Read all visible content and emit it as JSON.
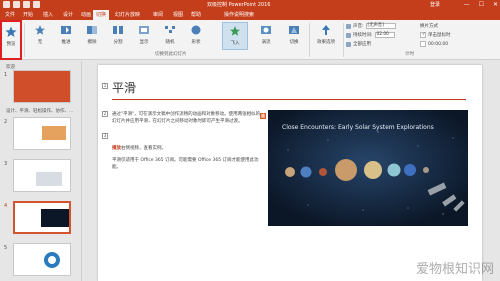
{
  "window": {
    "title": "双级控制 PowerPoint 2016",
    "signin": "登录"
  },
  "tabs": [
    "文件",
    "开始",
    "插入",
    "设计",
    "切换",
    "动画",
    "幻灯片放映",
    "审阅",
    "视图",
    "帮助"
  ],
  "active_tab": "切换",
  "tell_me": "操作说明搜索",
  "ribbon": {
    "preview_label": "预览",
    "preview_group": "预览",
    "transitions": [
      "无",
      "推进",
      "擦除",
      "分割",
      "显示",
      "随机",
      "形状",
      "飞入",
      "涡流",
      "切换"
    ],
    "transitions_group": "切换到此幻灯片",
    "effect_options": "效果选项",
    "sound_label": "声音:",
    "sound_value": "[无声音]",
    "duration_label": "持续时间:",
    "duration_value": "02.00",
    "apply_all": "全部应用",
    "timing_group": "计时",
    "advance_label": "换片方式",
    "on_click": "单击鼠标时",
    "after_label": "设置自动换片时间:",
    "after_value": "00:00.00"
  },
  "thumbnails": {
    "sections": [
      "欢迎",
      "设计、平滑、轻松操作、协作、..."
    ],
    "numbers": [
      "1",
      "2",
      "3",
      "4",
      "5"
    ],
    "selected": "4"
  },
  "slide": {
    "title": "平滑",
    "p1": "通过\"平滑\"，可在演示文稿中创作流畅的动画和对象移动。使用两张相似的幻灯片并应用平滑，在幻灯片之间移动对象时即可产生平滑过渡。",
    "p2_hl": "播放",
    "p2": "右侧视频，查看实例。",
    "p3": "平滑仅适用于 Office 365 订阅。可能需要 Office 365 订阅才能使用此功能。",
    "image_caption": "Close Encounters: Early Solar System Explorations",
    "markers": [
      "1",
      "2",
      "3"
    ],
    "marker4": "4"
  },
  "watermark": "爱物根知识网"
}
